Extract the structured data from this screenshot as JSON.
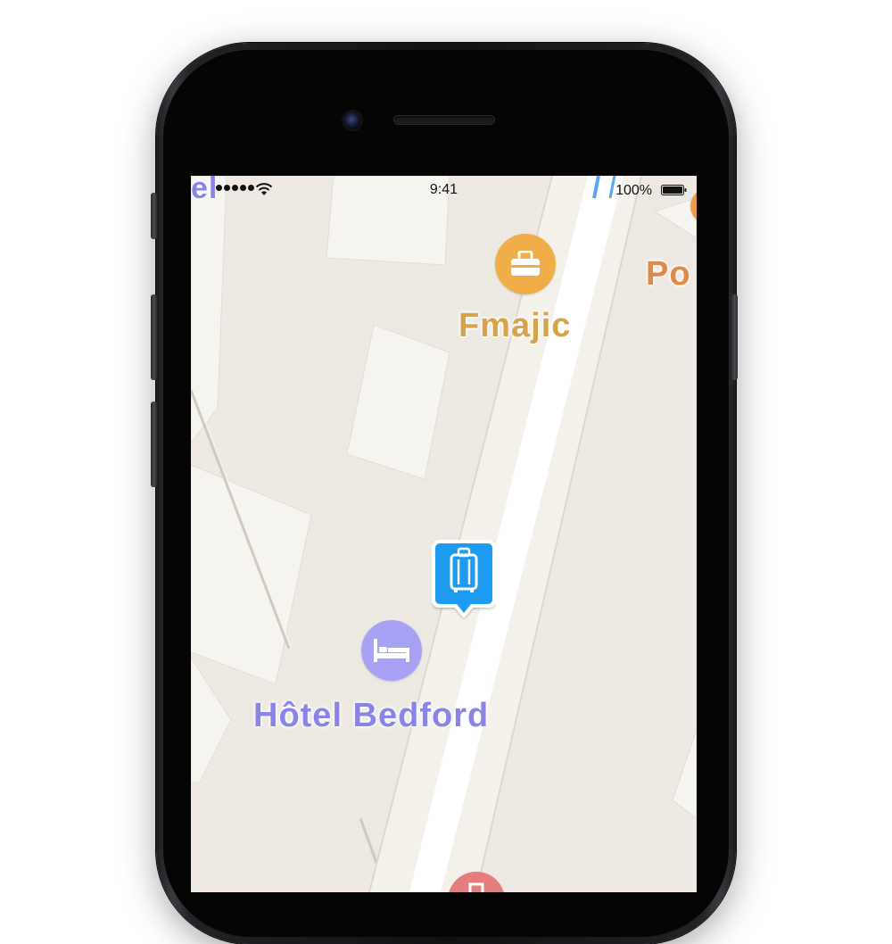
{
  "status_bar": {
    "time": "9:41",
    "battery_percent": "100%",
    "signal_bars": 5,
    "wifi_icon": "wifi-icon",
    "battery_icon": "battery-full-icon"
  },
  "map": {
    "pois": [
      {
        "name": "Fmajic",
        "category": "shopping",
        "icon": "shopping-bag-icon",
        "color": "#efae47"
      },
      {
        "name": "Hôtel Bedford",
        "category": "hotel",
        "icon": "bed-icon",
        "color": "#a8a2f5"
      }
    ],
    "partial_labels": {
      "top_right": "Po",
      "top_left": "el"
    },
    "selected_pin": {
      "icon": "luggage-icon",
      "color": "#1e9bf0"
    },
    "partial_pins": [
      {
        "icon": "orange-poi-icon",
        "color": "#ec9a4a"
      },
      {
        "icon": "medical-poi-icon",
        "color": "#e67d7d"
      }
    ]
  }
}
